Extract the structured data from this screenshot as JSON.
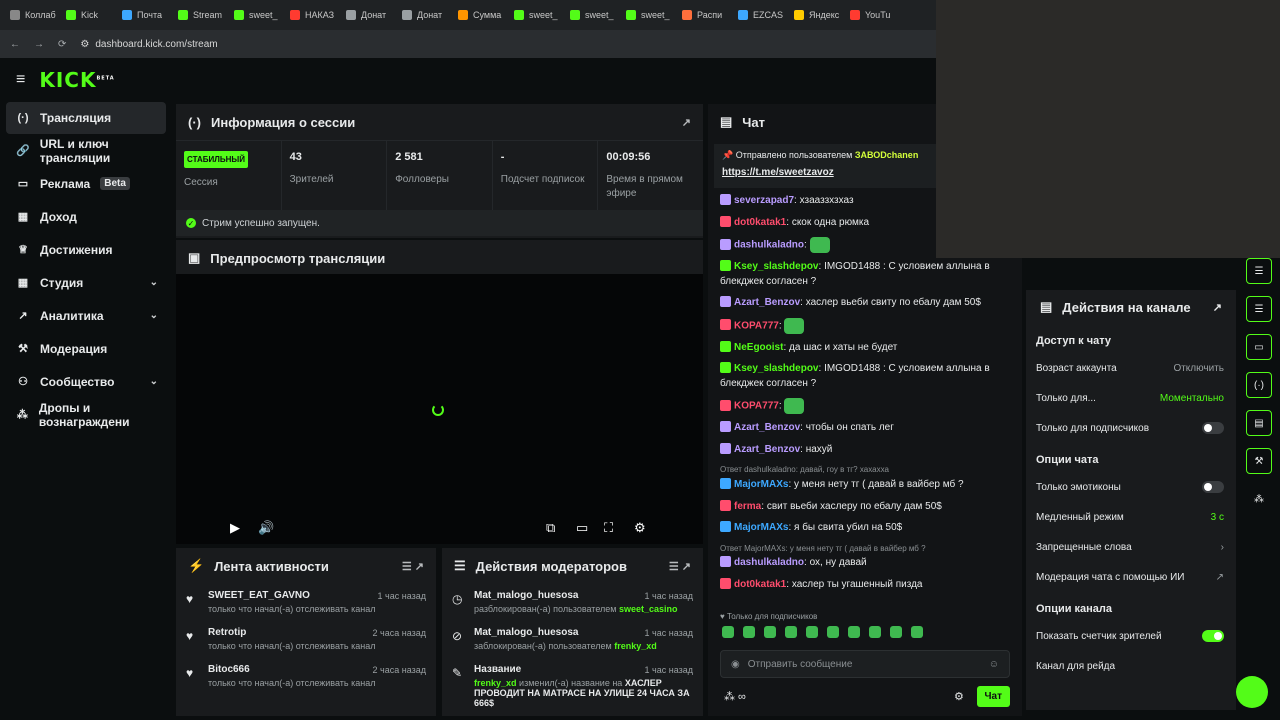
{
  "browser": {
    "tabs": [
      "Коллаб",
      "Kick",
      "Почта",
      "Stream",
      "sweet_",
      "НАКАЗ",
      "Донат",
      "Донат",
      "Сумма",
      "sweet_",
      "sweet_",
      "sweet_",
      "Распи",
      "EZCAS",
      "Яндекс",
      "YouTu"
    ],
    "url": "dashboard.kick.com/stream"
  },
  "brand": {
    "logo": "KICK",
    "beta": "BETA"
  },
  "sidebar": {
    "items": [
      {
        "label": "Трансляция",
        "icon": "broadcast-icon"
      },
      {
        "label": "URL и ключ трансляции",
        "icon": "link-icon"
      },
      {
        "label": "Реклама",
        "icon": "ad-icon",
        "badge": "Beta"
      },
      {
        "label": "Доход",
        "icon": "revenue-icon"
      },
      {
        "label": "Достижения",
        "icon": "trophy-icon"
      },
      {
        "label": "Студия",
        "icon": "studio-icon"
      },
      {
        "label": "Аналитика",
        "icon": "analytics-icon"
      },
      {
        "label": "Модерация",
        "icon": "moderation-icon"
      },
      {
        "label": "Сообщество",
        "icon": "community-icon"
      },
      {
        "label": "Дропы и вознаграждени",
        "icon": "drops-icon"
      }
    ]
  },
  "session": {
    "title": "Информация о сессии",
    "status": "СТАБИЛЬНЫЙ",
    "status_label": "Сессия",
    "viewers": "43",
    "viewers_label": "Зрителей",
    "followers": "2 581",
    "followers_label": "Фолловеры",
    "subs": "-",
    "subs_label": "Подсчет подписок",
    "uptime": "00:09:56",
    "uptime_label": "Время в прямом эфире",
    "notice": "Стрим успешно запущен."
  },
  "preview": {
    "title": "Предпросмотр трансляции"
  },
  "activity": {
    "title": "Лента активности",
    "rows": [
      {
        "name": "SWEET_EAT_GAVNO",
        "sub": "только что начал(-а) отслеживать канал",
        "time": "1 час назад"
      },
      {
        "name": "Retrotip",
        "sub": "только что начал(-а) отслеживать канал",
        "time": "2 часа назад"
      },
      {
        "name": "Bitoc666",
        "sub": "только что начал(-а) отслеживать канал",
        "time": "2 часа назад"
      }
    ]
  },
  "modactions": {
    "title": "Действия модераторов",
    "rows": [
      {
        "name": "Mat_malogo_huesosa",
        "sub": "разблокирован(-а) пользователем",
        "who": "sweet_casino",
        "time": "1 час назад"
      },
      {
        "name": "Mat_malogo_huesosa",
        "sub": "заблокирован(-а) пользователем",
        "who": "frenky_xd",
        "time": "1 час назад"
      },
      {
        "name": "Название",
        "who": "frenky_xd",
        "sub": "изменил(-а) название на",
        "extra": "ХАСЛЕР ПРОВОДИТ НА МАТРАСЕ НА УЛИЦЕ 24 ЧАСА ЗА 666$",
        "time": "1 час назад"
      }
    ]
  },
  "chat": {
    "title": "Чат",
    "pinned_by": "Отправлено пользователем",
    "pinned_user": "ЗАВОDchanen",
    "pinned_link": "https://t.me/sweetzavoz",
    "messages": [
      {
        "user": "severzapad7",
        "text": "хзааззхзхаз",
        "color": "#b99cff"
      },
      {
        "user": "dot0katak1",
        "text": "скок одна рюмка",
        "color": "#ff4d6d"
      },
      {
        "user": "dashulkaladno",
        "text": "",
        "color": "#b99cff"
      },
      {
        "user": "Ksey_slashdepov",
        "text": "IMGOD1488 : С условием аллына в блекджек согласен ?",
        "color": "#53fc18"
      },
      {
        "user": "Azart_Benzov",
        "text": "хаслер вьеби свиту по ебалу дам 50$",
        "color": "#b99cff"
      },
      {
        "user": "KOPA777",
        "text": "",
        "color": "#ff4d6d"
      },
      {
        "user": "NeEgooist",
        "text": "да шас и хаты не будет",
        "color": "#53fc18"
      },
      {
        "user": "Ksey_slashdepov",
        "text": "IMGOD1488 : С условием аллына в блекджек согласен ?",
        "color": "#53fc18"
      },
      {
        "user": "KOPA777",
        "text": "",
        "color": "#ff4d6d"
      },
      {
        "user": "Azart_Benzov",
        "text": "чтобы он спать лег",
        "color": "#b99cff"
      },
      {
        "user": "Azart_Benzov",
        "text": "нахуй",
        "color": "#b99cff"
      },
      {
        "reply": "Ответ dashulkaladno: давай, гоу в тг? хахахха",
        "user": "MajorMAXs",
        "text": "у меня нету тг ( давай в вайбер мб ?",
        "color": "#3da8ff"
      },
      {
        "user": "ferma",
        "text": "свит вьеби хаслеру по ебалу дам 50$",
        "color": "#ff4d6d"
      },
      {
        "user": "MajorMAXs",
        "text": "я бы свита убил на 50$",
        "color": "#3da8ff"
      },
      {
        "reply": "Ответ MajorMAXs: у меня нету тг ( давай в вайбер мб ?",
        "user": "dashulkaladno",
        "text": "ох, ну давай",
        "color": "#b99cff"
      },
      {
        "user": "dot0katak1",
        "text": "хаслер ты угашенный пизда",
        "color": "#ff4d6d"
      }
    ],
    "subs_only": "Только для подписчиков",
    "placeholder": "Отправить сообщение",
    "send": "Чат"
  },
  "channel_actions": {
    "title": "Действия на канале",
    "chat_access": "Доступ к чату",
    "age": "Возраст аккаунта",
    "age_val": "Отключить",
    "only_for": "Только для...",
    "only_for_val": "Моментально",
    "subs_only": "Только для подписчиков",
    "chat_options": "Опции чата",
    "emotes_only": "Только эмотиконы",
    "slow": "Медленный режим",
    "slow_val": "3 с",
    "banned": "Запрещенные слова",
    "ai_mod": "Модерация чата с помощью ИИ",
    "channel_opts": "Опции канала",
    "show_viewers": "Показать счетчик зрителей",
    "raid": "Канал для рейда"
  }
}
